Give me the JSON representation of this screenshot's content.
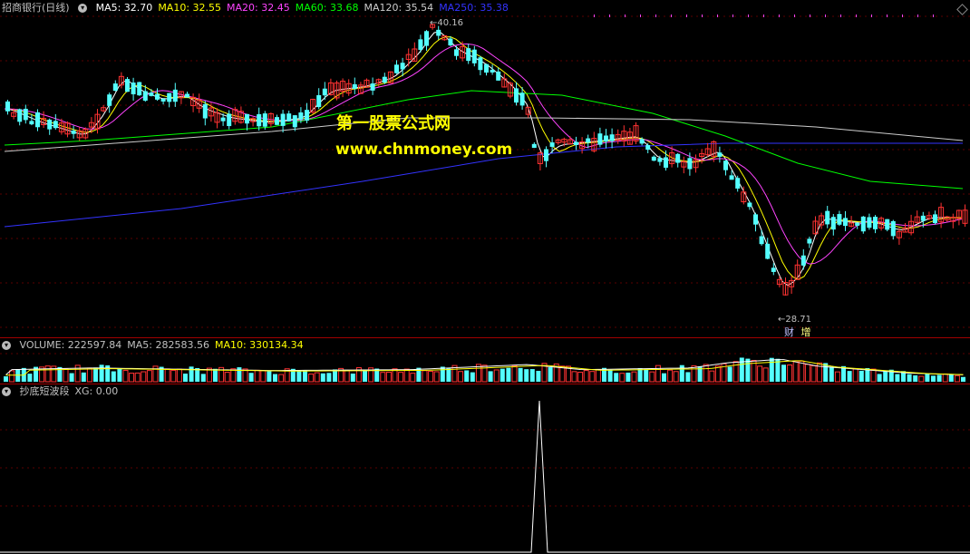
{
  "main": {
    "title": "招商银行(日线)",
    "ma": [
      {
        "label": "MA5: 32.70",
        "color": "#ffffff"
      },
      {
        "label": "MA10: 32.55",
        "color": "#ffff00"
      },
      {
        "label": "MA20: 32.45",
        "color": "#ff44ff"
      },
      {
        "label": "MA60: 33.68",
        "color": "#00ff00"
      },
      {
        "label": "MA120: 35.54",
        "color": "#cccccc"
      },
      {
        "label": "MA250: 35.38",
        "color": "#3333ff"
      }
    ],
    "high_label": "40.16",
    "low_label": "28.71",
    "event_labels": [
      "财",
      "增"
    ]
  },
  "watermark": {
    "line1": "第一股票公式网",
    "line2": "www.chnmoney.com"
  },
  "volume": {
    "legend": [
      {
        "label": "VOLUME: 222597.84",
        "color": "#c0c0c0"
      },
      {
        "label": "MA5: 282583.56",
        "color": "#c0c0c0"
      },
      {
        "label": "MA10: 330134.34",
        "color": "#ffff00"
      }
    ]
  },
  "indicator": {
    "legend": [
      {
        "label": "抄底短波段",
        "color": "#c0c0c0"
      },
      {
        "label": "XG: 0.00",
        "color": "#c0c0c0"
      }
    ]
  },
  "colors": {
    "up": "#ff3232",
    "down": "#54ffff",
    "grid": "#5a0000",
    "ma5": "#ffffff",
    "ma10": "#ffff00",
    "ma20": "#ff44ff",
    "ma60": "#00ff00",
    "ma120": "#cccccc",
    "ma250": "#3333ff"
  }
}
